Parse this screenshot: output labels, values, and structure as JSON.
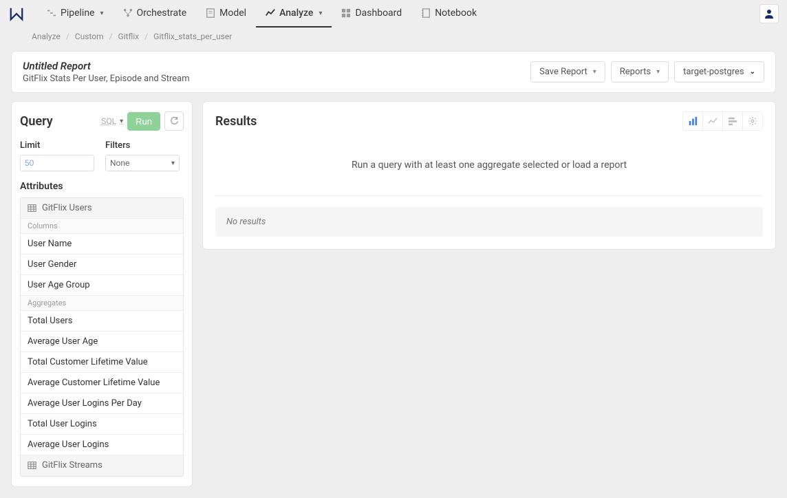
{
  "nav": {
    "items": [
      {
        "label": "Pipeline",
        "dropdown": true
      },
      {
        "label": "Orchestrate",
        "dropdown": false
      },
      {
        "label": "Model",
        "dropdown": false
      },
      {
        "label": "Analyze",
        "dropdown": true,
        "active": true
      },
      {
        "label": "Dashboard",
        "dropdown": false
      },
      {
        "label": "Notebook",
        "dropdown": false
      }
    ]
  },
  "breadcrumb": [
    "Analyze",
    "Custom",
    "Gitflix",
    "Gitflix_stats_per_user"
  ],
  "report": {
    "title": "Untitled Report",
    "subtitle": "GitFlix Stats Per User, Episode and Stream"
  },
  "header_actions": {
    "save_report": "Save Report",
    "reports": "Reports",
    "target": "target-postgres"
  },
  "query": {
    "title": "Query",
    "sql_label": "SQL",
    "run_label": "Run",
    "limit_label": "Limit",
    "limit_value": "50",
    "filters_label": "Filters",
    "filters_value": "None",
    "attributes_label": "Attributes",
    "tables": [
      {
        "name": "GitFlix Users",
        "columns_label": "Columns",
        "columns": [
          "User Name",
          "User Gender",
          "User Age Group"
        ],
        "aggregates_label": "Aggregates",
        "aggregates": [
          "Total Users",
          "Average User Age",
          "Total Customer Lifetime Value",
          "Average Customer Lifetime Value",
          "Average User Logins Per Day",
          "Total User Logins",
          "Average User Logins"
        ]
      },
      {
        "name": "GitFlix Streams"
      }
    ]
  },
  "results": {
    "title": "Results",
    "prompt": "Run a query with at least one aggregate selected or load a report",
    "no_results": "No results"
  }
}
